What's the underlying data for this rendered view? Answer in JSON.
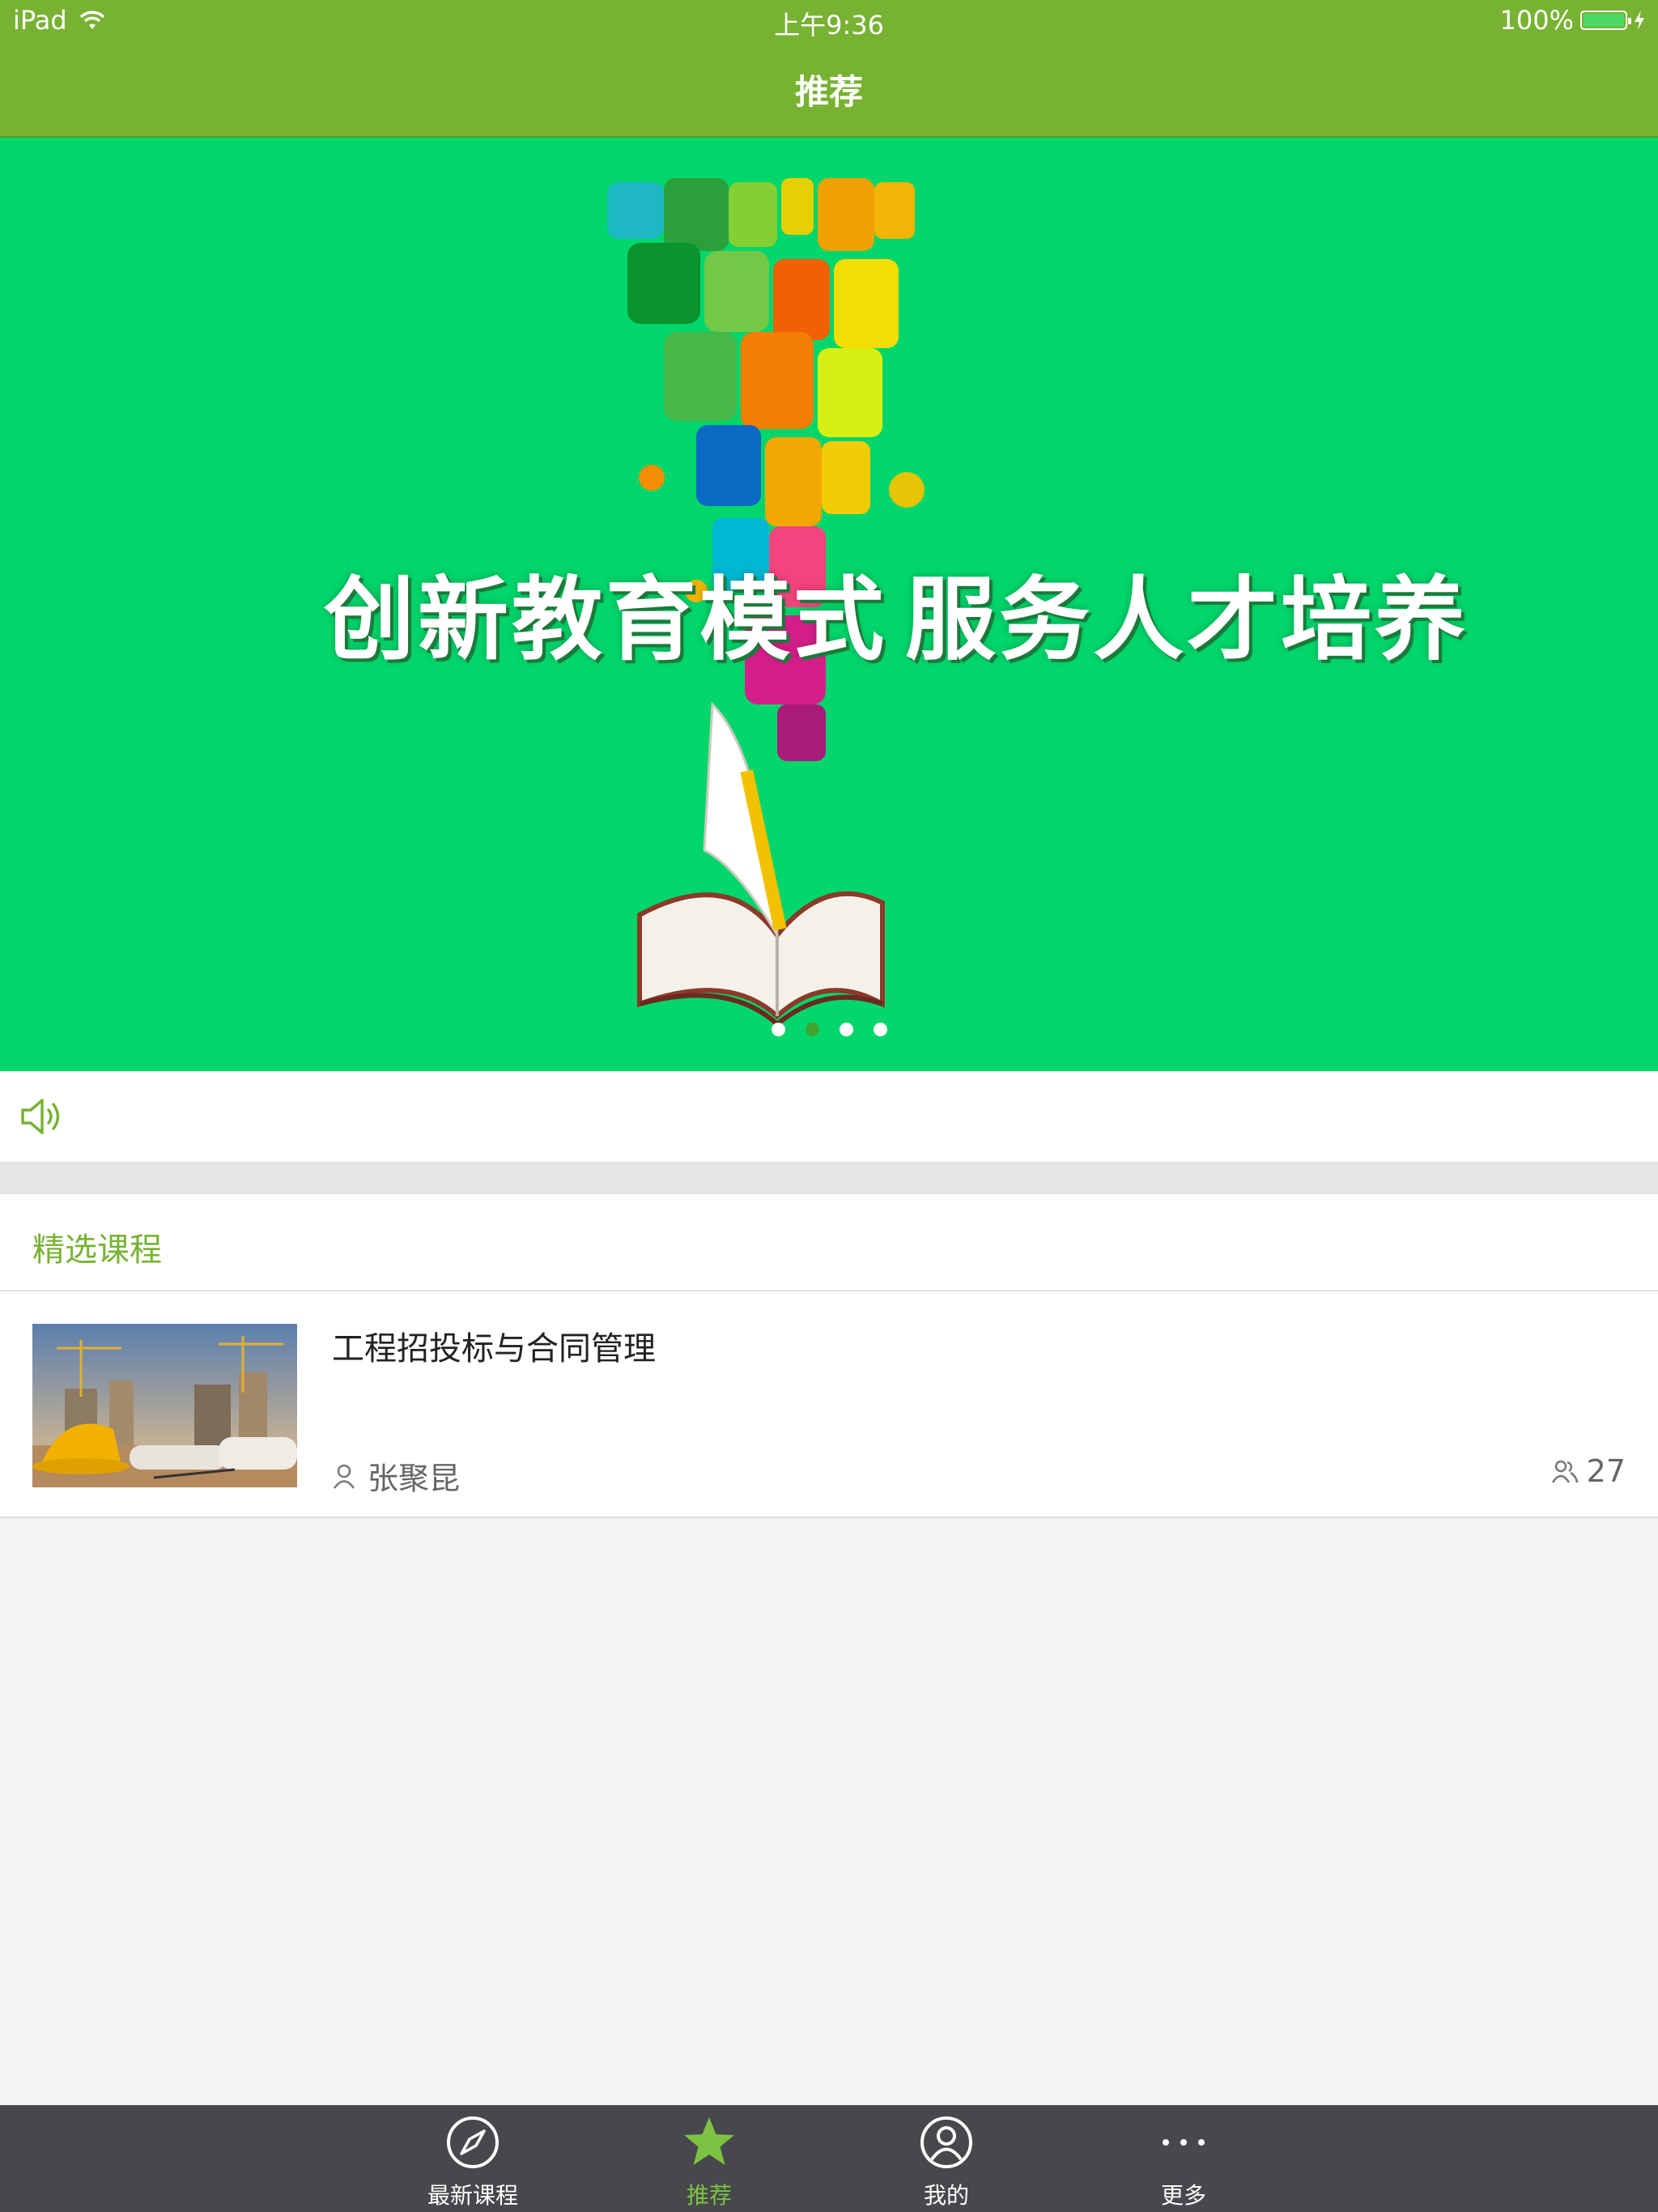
{
  "status_bar": {
    "device": "iPad",
    "time": "上午9:36",
    "battery": "100%"
  },
  "nav": {
    "title": "推荐"
  },
  "banner": {
    "left_text": "创新教育模式",
    "right_text": "服务人才培养",
    "slide_count": 4,
    "active_slide": 2
  },
  "notice": {
    "icon": "speaker-icon"
  },
  "section": {
    "title": "精选课程"
  },
  "courses": [
    {
      "title": "工程招投标与合同管理",
      "author": "张聚昆",
      "count": "27",
      "thumb": "construction-site-image"
    }
  ],
  "tabbar": {
    "items": [
      {
        "label": "最新课程",
        "icon": "compass-icon"
      },
      {
        "label": "推荐",
        "icon": "star-icon",
        "active": true
      },
      {
        "label": "我的",
        "icon": "user-icon"
      },
      {
        "label": "更多",
        "icon": "more-icon"
      }
    ]
  },
  "colors": {
    "header": "#78b233",
    "banner": "#00d66b",
    "accent": "#78b233",
    "tabbar": "#47484c",
    "tab_active": "#7dc242"
  }
}
